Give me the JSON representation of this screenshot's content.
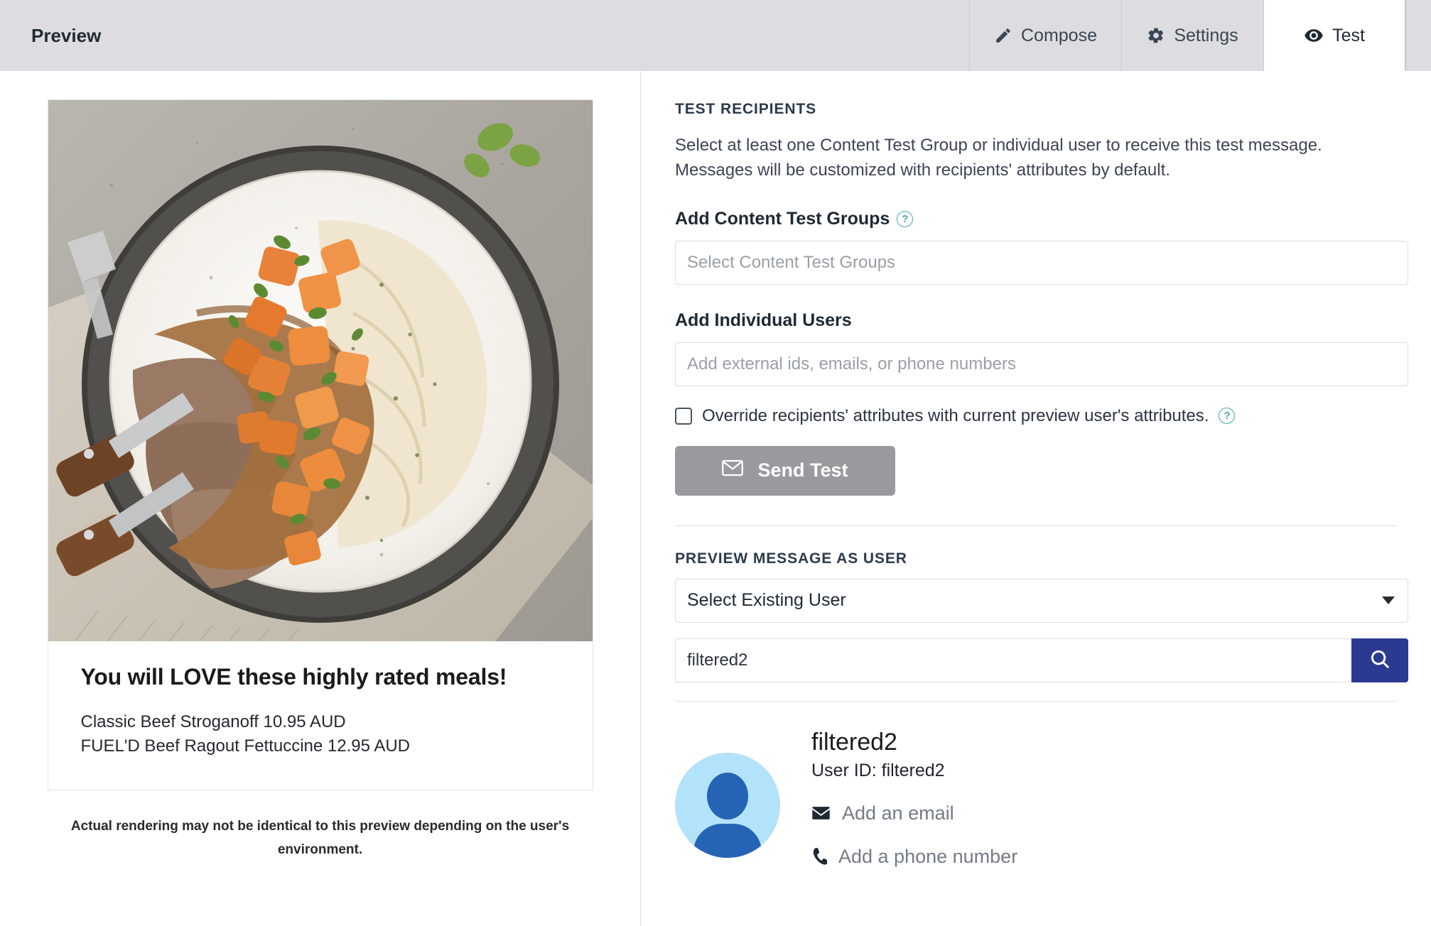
{
  "header": {
    "title": "Preview",
    "tabs": [
      {
        "label": "Compose",
        "icon": "pencil-icon",
        "active": false
      },
      {
        "label": "Settings",
        "icon": "gear-icon",
        "active": false
      },
      {
        "label": "Test",
        "icon": "eye-icon",
        "active": true
      }
    ]
  },
  "preview": {
    "email": {
      "heading": "You will LOVE these highly rated meals!",
      "lines": [
        "Classic Beef Stroganoff  10.95 AUD",
        "FUEL'D Beef Ragout Fettuccine  12.95 AUD"
      ]
    },
    "disclaimer": "Actual rendering may not be identical to this preview depending on the user's environment."
  },
  "test_recipients": {
    "section_title": "TEST RECIPIENTS",
    "description": "Select at least one Content Test Group or individual user to receive this test message. Messages will be customized with recipients' attributes by default.",
    "content_test_groups": {
      "label": "Add Content Test Groups",
      "help": "?",
      "placeholder": "Select Content Test Groups",
      "value": ""
    },
    "individual_users": {
      "label": "Add Individual Users",
      "placeholder": "Add external ids, emails, or phone numbers",
      "value": ""
    },
    "override_checkbox": {
      "label": "Override recipients' attributes with current preview user's attributes.",
      "help": "?",
      "checked": false
    },
    "send_test_button": {
      "label": "Send Test",
      "icon": "envelope-icon",
      "color": "#9a9a9e",
      "disabled": true
    }
  },
  "preview_as_user": {
    "section_title": "PREVIEW MESSAGE AS USER",
    "select": {
      "value": "Select Existing User",
      "icon": "chevron-down-icon"
    },
    "search": {
      "value": "filtered2",
      "placeholder": "",
      "button_icon": "search-icon",
      "button_color": "#2b3990"
    },
    "result": {
      "name": "filtered2",
      "user_id_label": "User ID: filtered2",
      "add_email": "Add an email",
      "add_phone": "Add a phone number",
      "avatar_icon": "user-avatar-icon"
    }
  }
}
